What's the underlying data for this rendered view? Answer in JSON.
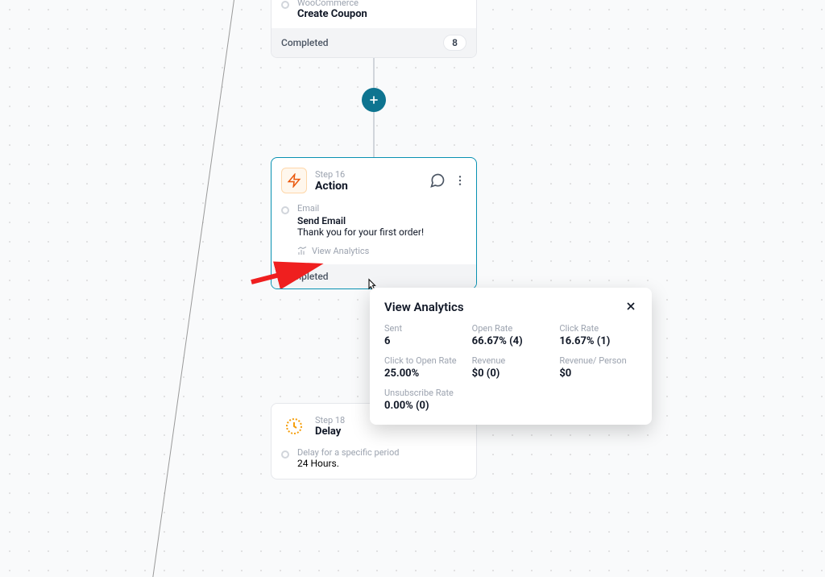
{
  "topCard": {
    "category": "WooCommerce",
    "title": "Create Coupon",
    "footer_label": "Completed",
    "count": "8"
  },
  "actionCard": {
    "step_label": "Step 16",
    "type_label": "Action",
    "sub_label": "Email",
    "action_title": "Send Email",
    "description": "Thank you for your first order!",
    "view_analytics_label": "View Analytics",
    "footer_label": "Completed"
  },
  "analytics": {
    "title": "View Analytics",
    "stats": {
      "sent": {
        "label": "Sent",
        "value": "6"
      },
      "open_rate": {
        "label": "Open Rate",
        "value": "66.67% (4)"
      },
      "click_rate": {
        "label": "Click Rate",
        "value": "16.67% (1)"
      },
      "click_to_open": {
        "label": "Click to Open Rate",
        "value": "25.00%"
      },
      "revenue": {
        "label": "Revenue",
        "value": "$0 (0)"
      },
      "revenue_person": {
        "label": "Revenue/ Person",
        "value": "$0"
      },
      "unsubscribe": {
        "label": "Unsubscribe Rate",
        "value": "0.00% (0)"
      }
    }
  },
  "delayCard": {
    "step_label": "Step 18",
    "type_label": "Delay",
    "desc_label": "Delay for a specific period",
    "duration": "24 Hours."
  }
}
